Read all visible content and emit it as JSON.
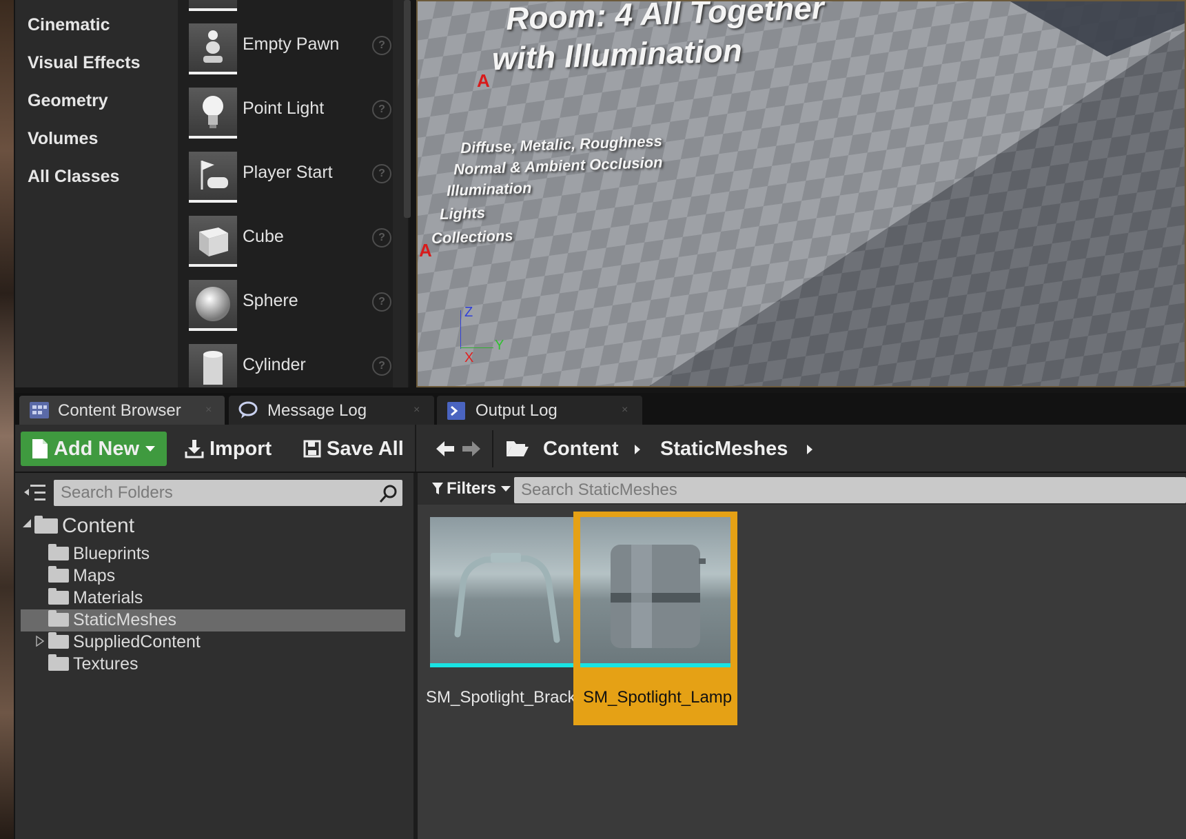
{
  "place_actors": {
    "categories": [
      "Cinematic",
      "Visual Effects",
      "Geometry",
      "Volumes",
      "All Classes"
    ],
    "items": [
      {
        "label": "Empty Pawn",
        "icon": "pawn-icon"
      },
      {
        "label": "Point Light",
        "icon": "lightbulb-icon"
      },
      {
        "label": "Player Start",
        "icon": "player-start-icon"
      },
      {
        "label": "Cube",
        "icon": "cube-icon"
      },
      {
        "label": "Sphere",
        "icon": "sphere-icon"
      },
      {
        "label": "Cylinder",
        "icon": "cylinder-icon"
      }
    ],
    "help_glyph": "?"
  },
  "viewport": {
    "title_line1": "Room: 4 All Together",
    "title_line2": "with Illumination",
    "list": [
      "Diffuse, Metalic, Roughness",
      "Normal & Ambient Occlusion",
      "Illumination",
      "Lights",
      "Collections"
    ],
    "axis": {
      "z": "Z",
      "y": "Y",
      "x": "X"
    },
    "marker": "A"
  },
  "tabs": [
    {
      "label": "Content Browser",
      "icon": "content-browser-icon",
      "active": true
    },
    {
      "label": "Message Log",
      "icon": "message-log-icon",
      "active": false
    },
    {
      "label": "Output Log",
      "icon": "output-log-icon",
      "active": false
    }
  ],
  "close_glyph": "×",
  "toolbar": {
    "add_new": "Add New",
    "import": "Import",
    "save_all": "Save All",
    "path": [
      "Content",
      "StaticMeshes"
    ]
  },
  "folders": {
    "search_placeholder": "Search Folders",
    "root": "Content",
    "children": [
      "Blueprints",
      "Maps",
      "Materials",
      "StaticMeshes",
      "SuppliedContent",
      "Textures"
    ],
    "selected": "StaticMeshes"
  },
  "assets": {
    "filters_label": "Filters",
    "search_placeholder": "Search StaticMeshes",
    "items": [
      {
        "name": "SM_Spotlight_Bracket",
        "selected": false
      },
      {
        "name": "SM_Spotlight_Lamp",
        "selected": true
      }
    ]
  },
  "colors": {
    "accent_green": "#3f9a3f",
    "selection_orange": "#e5a115",
    "asset_bar_cyan": "#19e3e3"
  }
}
